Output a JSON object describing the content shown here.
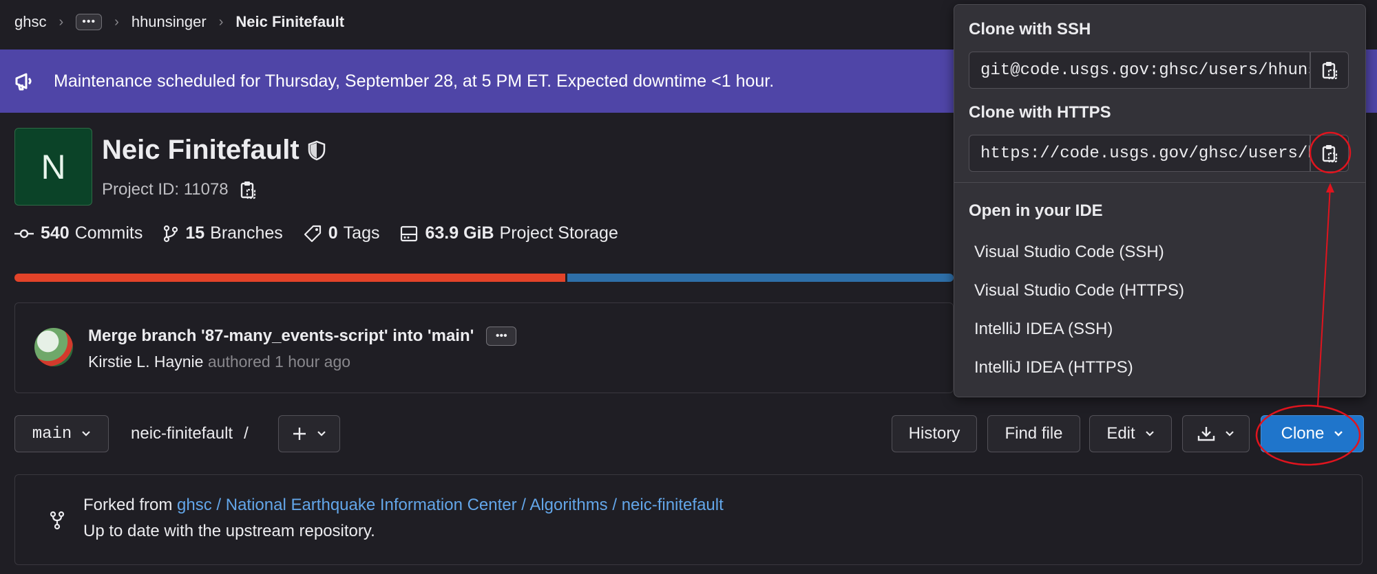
{
  "breadcrumb": {
    "items": [
      "ghsc",
      "•••",
      "hhunsinger"
    ],
    "current": "Neic Finitefault"
  },
  "banner": {
    "text": "Maintenance scheduled for Thursday, September 28, at 5 PM ET. Expected downtime <1 hour.",
    "icon": "megaphone-icon"
  },
  "project": {
    "avatar_letter": "N",
    "name": "Neic Finitefault",
    "id_label": "Project ID: 11078"
  },
  "stats": {
    "commits": {
      "count": "540",
      "label": "Commits"
    },
    "branches": {
      "count": "15",
      "label": "Branches"
    },
    "tags": {
      "count": "0",
      "label": "Tags"
    },
    "storage": {
      "count": "63.9 GiB",
      "label": "Project Storage"
    }
  },
  "languages": {
    "colors": [
      "#e24329",
      "#2e6fa8"
    ],
    "fractions": [
      0.588,
      0.412
    ]
  },
  "commit": {
    "message": "Merge branch '87-many_events-script' into 'main'",
    "dots": "•••",
    "author": "Kirstie L. Haynie",
    "meta": " authored 1 hour ago"
  },
  "toolbar": {
    "branch": "main",
    "path": "neic-finitefault",
    "slash": "/",
    "history": "History",
    "find_file": "Find file",
    "edit": "Edit",
    "clone": "Clone"
  },
  "fork": {
    "prefix": "Forked from ",
    "link": "ghsc / National Earthquake Information Center / Algorithms / neic-finitefault",
    "status": "Up to date with the upstream repository."
  },
  "clone_dropdown": {
    "ssh_title": "Clone with SSH",
    "ssh_url": "git@code.usgs.gov:ghsc/users/hhunsinger/neic-finitefault.git",
    "https_title": "Clone with HTTPS",
    "https_url": "https://code.usgs.gov/ghsc/users/hhunsinger/neic-finitefault.git",
    "ide_title": "Open in your IDE",
    "ide_items": [
      "Visual Studio Code (SSH)",
      "Visual Studio Code (HTTPS)",
      "IntelliJ IDEA (SSH)",
      "IntelliJ IDEA (HTTPS)"
    ]
  },
  "colors": {
    "background": "#1f1e24",
    "banner": "#4f45a7",
    "accent_blue": "#1f75cb",
    "annotation_red": "#e0141e"
  }
}
